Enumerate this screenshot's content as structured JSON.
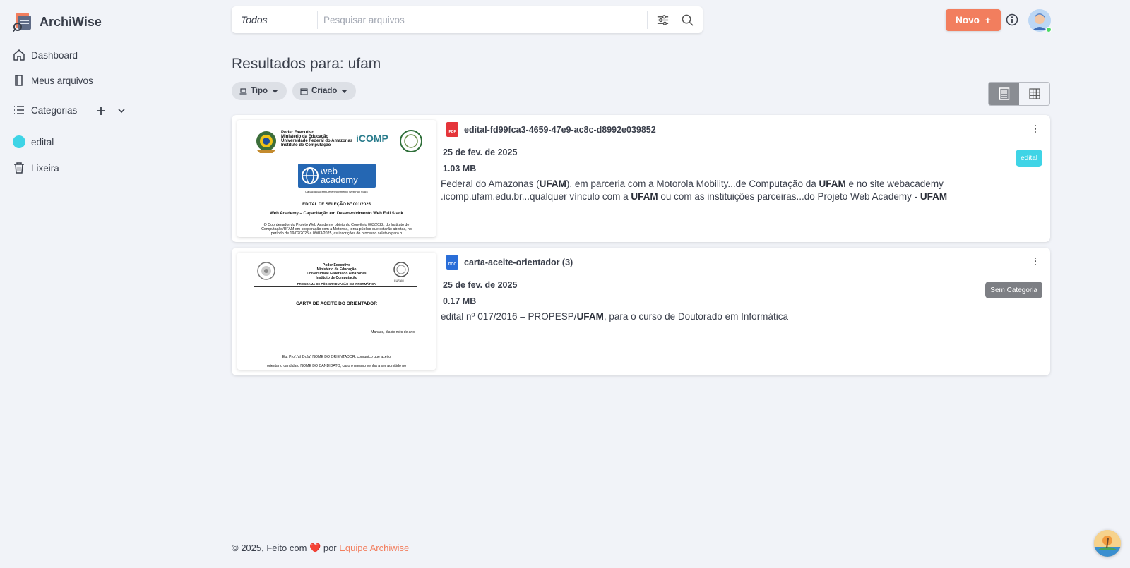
{
  "app": {
    "name": "ArchiWise"
  },
  "sidebar": {
    "items": [
      {
        "label": "Dashboard"
      },
      {
        "label": "Meus arquivos"
      },
      {
        "label": "Categorias"
      },
      {
        "label": "edital"
      },
      {
        "label": "Lixeira"
      }
    ]
  },
  "search": {
    "scope": "Todos",
    "placeholder": "Pesquisar arquivos"
  },
  "header": {
    "new_label": "Novo",
    "new_plus": "+"
  },
  "results": {
    "title": "Resultados para: ufam"
  },
  "filters": [
    {
      "label": "Tipo"
    },
    {
      "label": "Criado"
    }
  ],
  "files": [
    {
      "name": "edital-fd99fca3-4659-47e9-ac8c-d8992e039852",
      "type": "PDF",
      "date": "25 de fev. de 2025",
      "size": "1.03 MB",
      "category": "edital",
      "category_color": "#3fd4e6",
      "snippet": {
        "l1a": "Federal do Amazonas (",
        "l1b": "UFAM",
        "l1c": "), em parceria com a Motorola Mobility...de Computação da ",
        "l1d": "UFAM",
        "l1e": " e no site webacademy",
        "l2a": ".icomp.ufam.edu.br...qualquer vínculo com a ",
        "l2b": "UFAM",
        "l2c": " ou com as instituições parceiras...do Projeto Web Academy - ",
        "l2d": "UFAM"
      },
      "thumb": {
        "h1": "Poder Executivo",
        "h2": "Ministério da Educação",
        "h3": "Universidade Federal do Amazonas",
        "h4": "Instituto de Computação",
        "logo_text": "iCOMP",
        "wa_text": "web academy",
        "wa_sub": "Capacitação em Desenvolvimento Web Full Stack",
        "title": "EDITAL DE SELEÇÃO Nº 001/2025",
        "subtitle": "Web Academy – Capacitação em Desenvolvimento Web Full Stack",
        "body1": "O Coordenador do Projeto Web Academy, objeto do Convênio 003/2022, do Instituto de",
        "body2": "Computação/UFAM em cooperação com a Motorola, torna público que estarão abertas, no",
        "body3": "período de 19/02/2025 a 09/03/2025, as inscrições do processo seletivo para o"
      }
    },
    {
      "name": "carta-aceite-orientador (3)",
      "type": "DOC",
      "date": "25 de fev. de 2025",
      "size": "0.17 MB",
      "category": "Sem Categoria",
      "category_color": "#7d7f84",
      "snippet": {
        "l1a": "edital nº 017/2016 – PROPESP/",
        "l1b": "UFAM",
        "l1c": ", para o curso de Doutorado em Informática"
      },
      "thumb": {
        "h1": "Poder Executivo",
        "h2": "Ministério da Educação",
        "h3": "Universidade Federal do Amazonas",
        "h4": "Instituto de Computação",
        "logo_text": "I-UFAM",
        "program": "PROGRAMA DE PÓS-GRADUAÇÃO EM INFORMÁTICA",
        "title": "CARTA DE ACEITE DO ORIENTADOR",
        "place": "Manaus, dia de mês de ano",
        "body1": "Eu, Prof.(a) Dr.(a) NOME DO ORIENTADOR, comunico que aceito",
        "body2": "orientar o candidato NOME DO CANDIDATO, caso o mesmo venha a ser admitido no"
      }
    }
  ],
  "footer": {
    "text": "© 2025, Feito com",
    "heart": "❤️",
    "by": "por",
    "link": "Equipe Archiwise"
  }
}
